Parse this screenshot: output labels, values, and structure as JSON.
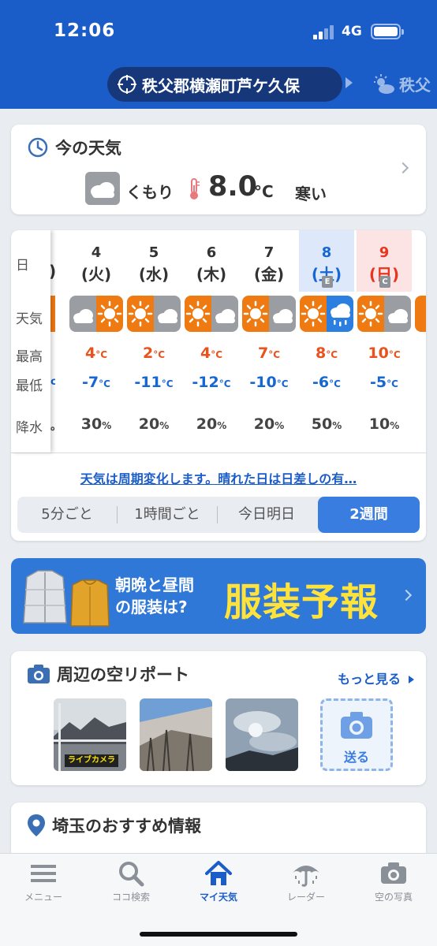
{
  "status_bar": {
    "time": "12:06",
    "network": "4G"
  },
  "location": {
    "current": "秩父郡横瀬町芦ケ久保",
    "next": "秩父"
  },
  "now": {
    "title": "今の天気",
    "weather": "くもり",
    "temp": "8.0",
    "unit": "°C",
    "feel": "寒い"
  },
  "forecast": {
    "row_labels": {
      "day": "日",
      "weather": "天気",
      "high": "最高",
      "low": "最低",
      "pop": "降水"
    },
    "partial": {
      "weekday": ")",
      "low_tail": "c",
      "pop_tail": "。"
    },
    "unit_c": "°C",
    "unit_pct": "%",
    "days": [
      {
        "date": "4",
        "weekday": "(火)",
        "weather_icon": "cloudy-then-sunny",
        "high": "4",
        "low": "-7",
        "pop": "30",
        "badge": ""
      },
      {
        "date": "5",
        "weekday": "(水)",
        "weather_icon": "sunny-then-cloudy",
        "high": "2",
        "low": "-11",
        "pop": "20",
        "badge": ""
      },
      {
        "date": "6",
        "weekday": "(木)",
        "weather_icon": "sunny-then-cloudy",
        "high": "4",
        "low": "-12",
        "pop": "20",
        "badge": ""
      },
      {
        "date": "7",
        "weekday": "(金)",
        "weather_icon": "sunny-then-cloudy",
        "high": "7",
        "low": "-10",
        "pop": "20",
        "badge": ""
      },
      {
        "date": "8",
        "weekday": "(土)",
        "weather_icon": "sunny-then-cloudy-rain",
        "high": "8",
        "low": "-6",
        "pop": "50",
        "badge": "E"
      },
      {
        "date": "9",
        "weekday": "(日)",
        "weather_icon": "sunny-then-cloudy",
        "high": "10",
        "low": "-5",
        "pop": "10",
        "badge": "C"
      }
    ],
    "note": "天気は周期変化します。晴れた日は日差しの有…",
    "tabs": [
      "5分ごと",
      "1時間ごと",
      "今日明日",
      "2週間"
    ],
    "active_tab": "2週間"
  },
  "banner": {
    "line1": "朝晩と昼間",
    "line2": "の服装は?",
    "big": "服装予報"
  },
  "sky_report": {
    "title": "周辺の空リポート",
    "more": "もっと見る",
    "live_label": "ライブカメラ",
    "send_label": "送る"
  },
  "saitama": {
    "title": "埼玉のおすすめ情報"
  },
  "bottom_nav": [
    {
      "label": "メニュー",
      "icon": "menu-icon"
    },
    {
      "label": "ココ検索",
      "icon": "search-icon"
    },
    {
      "label": "マイ天気",
      "icon": "home-icon"
    },
    {
      "label": "レーダー",
      "icon": "umbrella-icon"
    },
    {
      "label": "空の写真",
      "icon": "camera-icon"
    }
  ],
  "colors": {
    "header": "#1a5dc9",
    "sunny": "#f07a12",
    "cloudy": "#9a9ea3",
    "rain": "#2a7fe0",
    "high": "#e8521d",
    "low": "#1767d3",
    "saturday_bg": "#dde9fb",
    "sunday_bg": "#fde4e4"
  }
}
